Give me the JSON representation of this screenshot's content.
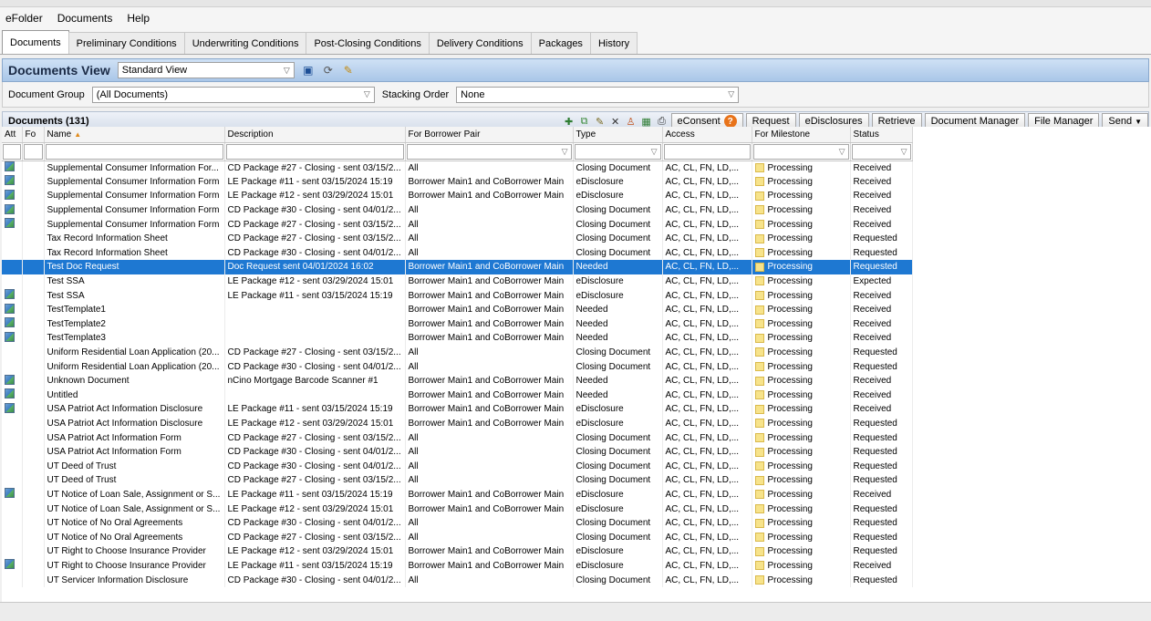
{
  "menu": [
    "eFolder",
    "Documents",
    "Help"
  ],
  "tabs": [
    "Documents",
    "Preliminary Conditions",
    "Underwriting Conditions",
    "Post-Closing Conditions",
    "Delivery Conditions",
    "Packages",
    "History"
  ],
  "view": {
    "title": "Documents View",
    "selected": "Standard View"
  },
  "filters": {
    "group_label": "Document Group",
    "group_value": "(All Documents)",
    "stacking_label": "Stacking Order",
    "stacking_value": "None"
  },
  "grid": {
    "title": "Documents (131)",
    "buttons": [
      "eConsent",
      "Request",
      "eDisclosures",
      "Retrieve",
      "Document Manager",
      "File Manager",
      "Send"
    ],
    "columns": [
      "Att",
      "Fo",
      "Name",
      "Description",
      "For Borrower Pair",
      "Type",
      "Access",
      "For Milestone",
      "Status"
    ]
  },
  "rows": [
    {
      "att": true,
      "name": "Supplemental Consumer Information For...",
      "desc": "CD Package #27 - Closing - sent 03/15/2...",
      "pair": "All",
      "type": "Closing Document",
      "access": "AC, CL, FN, LD,...",
      "milestone": "Processing",
      "status": "Received"
    },
    {
      "att": true,
      "name": "Supplemental Consumer Information Form",
      "desc": "LE Package #11 - sent 03/15/2024 15:19",
      "pair": "Borrower Main1 and CoBorrower Main",
      "type": "eDisclosure",
      "access": "AC, CL, FN, LD,...",
      "milestone": "Processing",
      "status": "Received"
    },
    {
      "att": true,
      "name": "Supplemental Consumer Information Form",
      "desc": "LE Package #12 - sent 03/29/2024 15:01",
      "pair": "Borrower Main1 and CoBorrower Main",
      "type": "eDisclosure",
      "access": "AC, CL, FN, LD,...",
      "milestone": "Processing",
      "status": "Received"
    },
    {
      "att": true,
      "name": "Supplemental Consumer Information Form",
      "desc": "CD Package #30 - Closing - sent 04/01/2...",
      "pair": "All",
      "type": "Closing Document",
      "access": "AC, CL, FN, LD,...",
      "milestone": "Processing",
      "status": "Received"
    },
    {
      "att": true,
      "name": "Supplemental Consumer Information Form",
      "desc": "CD Package #27 - Closing - sent 03/15/2...",
      "pair": "All",
      "type": "Closing Document",
      "access": "AC, CL, FN, LD,...",
      "milestone": "Processing",
      "status": "Received"
    },
    {
      "att": false,
      "name": "Tax Record Information Sheet",
      "desc": "CD Package #27 - Closing - sent 03/15/2...",
      "pair": "All",
      "type": "Closing Document",
      "access": "AC, CL, FN, LD,...",
      "milestone": "Processing",
      "status": "Requested"
    },
    {
      "att": false,
      "name": "Tax Record Information Sheet",
      "desc": "CD Package #30 - Closing - sent 04/01/2...",
      "pair": "All",
      "type": "Closing Document",
      "access": "AC, CL, FN, LD,...",
      "milestone": "Processing",
      "status": "Requested"
    },
    {
      "att": false,
      "sel": true,
      "name": "Test Doc Request",
      "desc": "Doc Request sent 04/01/2024 16:02",
      "pair": "Borrower Main1 and CoBorrower Main",
      "type": "Needed",
      "access": "AC, CL, FN, LD,...",
      "milestone": "Processing",
      "status": "Requested"
    },
    {
      "att": false,
      "name": "Test SSA",
      "desc": "LE Package #12 - sent 03/29/2024 15:01",
      "pair": "Borrower Main1 and CoBorrower Main",
      "type": "eDisclosure",
      "access": "AC, CL, FN, LD,...",
      "milestone": "Processing",
      "status": "Expected"
    },
    {
      "att": true,
      "name": "Test SSA",
      "desc": "LE Package #11 - sent 03/15/2024 15:19",
      "pair": "Borrower Main1 and CoBorrower Main",
      "type": "eDisclosure",
      "access": "AC, CL, FN, LD,...",
      "milestone": "Processing",
      "status": "Received"
    },
    {
      "att": true,
      "name": "TestTemplate1",
      "desc": "",
      "pair": "Borrower Main1 and CoBorrower Main",
      "type": "Needed",
      "access": "AC, CL, FN, LD,...",
      "milestone": "Processing",
      "status": "Received"
    },
    {
      "att": true,
      "name": "TestTemplate2",
      "desc": "",
      "pair": "Borrower Main1 and CoBorrower Main",
      "type": "Needed",
      "access": "AC, CL, FN, LD,...",
      "milestone": "Processing",
      "status": "Received"
    },
    {
      "att": true,
      "name": "TestTemplate3",
      "desc": "",
      "pair": "Borrower Main1 and CoBorrower Main",
      "type": "Needed",
      "access": "AC, CL, FN, LD,...",
      "milestone": "Processing",
      "status": "Received"
    },
    {
      "att": false,
      "name": "Uniform Residential Loan Application (20...",
      "desc": "CD Package #27 - Closing - sent 03/15/2...",
      "pair": "All",
      "type": "Closing Document",
      "access": "AC, CL, FN, LD,...",
      "milestone": "Processing",
      "status": "Requested"
    },
    {
      "att": false,
      "name": "Uniform Residential Loan Application (20...",
      "desc": "CD Package #30 - Closing - sent 04/01/2...",
      "pair": "All",
      "type": "Closing Document",
      "access": "AC, CL, FN, LD,...",
      "milestone": "Processing",
      "status": "Requested"
    },
    {
      "att": true,
      "name": "Unknown Document",
      "desc": "nCino Mortgage Barcode Scanner #1",
      "pair": "Borrower Main1 and CoBorrower Main",
      "type": "Needed",
      "access": "AC, CL, FN, LD,...",
      "milestone": "Processing",
      "status": "Received"
    },
    {
      "att": true,
      "name": "Untitled",
      "desc": "",
      "pair": "Borrower Main1 and CoBorrower Main",
      "type": "Needed",
      "access": "AC, CL, FN, LD,...",
      "milestone": "Processing",
      "status": "Received"
    },
    {
      "att": true,
      "name": "USA Patriot Act Information Disclosure",
      "desc": "LE Package #11 - sent 03/15/2024 15:19",
      "pair": "Borrower Main1 and CoBorrower Main",
      "type": "eDisclosure",
      "access": "AC, CL, FN, LD,...",
      "milestone": "Processing",
      "status": "Received"
    },
    {
      "att": false,
      "name": "USA Patriot Act Information Disclosure",
      "desc": "LE Package #12 - sent 03/29/2024 15:01",
      "pair": "Borrower Main1 and CoBorrower Main",
      "type": "eDisclosure",
      "access": "AC, CL, FN, LD,...",
      "milestone": "Processing",
      "status": "Requested"
    },
    {
      "att": false,
      "name": "USA Patriot Act Information Form",
      "desc": "CD Package #27 - Closing - sent 03/15/2...",
      "pair": "All",
      "type": "Closing Document",
      "access": "AC, CL, FN, LD,...",
      "milestone": "Processing",
      "status": "Requested"
    },
    {
      "att": false,
      "name": "USA Patriot Act Information Form",
      "desc": "CD Package #30 - Closing - sent 04/01/2...",
      "pair": "All",
      "type": "Closing Document",
      "access": "AC, CL, FN, LD,...",
      "milestone": "Processing",
      "status": "Requested"
    },
    {
      "att": false,
      "name": "UT Deed of Trust",
      "desc": "CD Package #30 - Closing - sent 04/01/2...",
      "pair": "All",
      "type": "Closing Document",
      "access": "AC, CL, FN, LD,...",
      "milestone": "Processing",
      "status": "Requested"
    },
    {
      "att": false,
      "name": "UT Deed of Trust",
      "desc": "CD Package #27 - Closing - sent 03/15/2...",
      "pair": "All",
      "type": "Closing Document",
      "access": "AC, CL, FN, LD,...",
      "milestone": "Processing",
      "status": "Requested"
    },
    {
      "att": true,
      "name": "UT Notice of Loan Sale, Assignment or S...",
      "desc": "LE Package #11 - sent 03/15/2024 15:19",
      "pair": "Borrower Main1 and CoBorrower Main",
      "type": "eDisclosure",
      "access": "AC, CL, FN, LD,...",
      "milestone": "Processing",
      "status": "Received"
    },
    {
      "att": false,
      "name": "UT Notice of Loan Sale, Assignment or S...",
      "desc": "LE Package #12 - sent 03/29/2024 15:01",
      "pair": "Borrower Main1 and CoBorrower Main",
      "type": "eDisclosure",
      "access": "AC, CL, FN, LD,...",
      "milestone": "Processing",
      "status": "Requested"
    },
    {
      "att": false,
      "name": "UT Notice of No Oral Agreements",
      "desc": "CD Package #30 - Closing - sent 04/01/2...",
      "pair": "All",
      "type": "Closing Document",
      "access": "AC, CL, FN, LD,...",
      "milestone": "Processing",
      "status": "Requested"
    },
    {
      "att": false,
      "name": "UT Notice of No Oral Agreements",
      "desc": "CD Package #27 - Closing - sent 03/15/2...",
      "pair": "All",
      "type": "Closing Document",
      "access": "AC, CL, FN, LD,...",
      "milestone": "Processing",
      "status": "Requested"
    },
    {
      "att": false,
      "name": "UT Right to Choose Insurance Provider",
      "desc": "LE Package #12 - sent 03/29/2024 15:01",
      "pair": "Borrower Main1 and CoBorrower Main",
      "type": "eDisclosure",
      "access": "AC, CL, FN, LD,...",
      "milestone": "Processing",
      "status": "Requested"
    },
    {
      "att": true,
      "name": "UT Right to Choose Insurance Provider",
      "desc": "LE Package #11 - sent 03/15/2024 15:19",
      "pair": "Borrower Main1 and CoBorrower Main",
      "type": "eDisclosure",
      "access": "AC, CL, FN, LD,...",
      "milestone": "Processing",
      "status": "Received"
    },
    {
      "att": false,
      "name": "UT Servicer Information Disclosure",
      "desc": "CD Package #30 - Closing - sent 04/01/2...",
      "pair": "All",
      "type": "Closing Document",
      "access": "AC, CL, FN, LD,...",
      "milestone": "Processing",
      "status": "Requested"
    }
  ]
}
